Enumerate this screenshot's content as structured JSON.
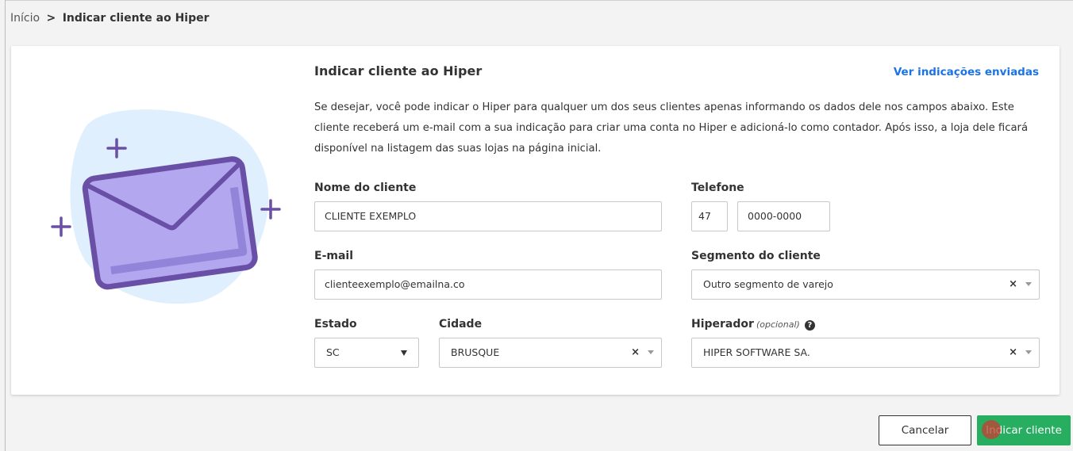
{
  "breadcrumb": {
    "home": "Início",
    "separator": ">",
    "current": "Indicar cliente ao Hiper"
  },
  "form": {
    "title": "Indicar cliente ao Hiper",
    "view_sent_link": "Ver indicações enviadas",
    "description": "Se desejar, você pode indicar o Hiper para qualquer um dos seus clientes apenas informando  os dados dele nos campos abaixo. Este cliente receberá um e-mail com a sua indicação para criar  uma conta no Hiper e adicioná-lo como contador. Após isso, a loja dele ficará disponível na  listagem das suas lojas na página inicial.",
    "client_name": {
      "label": "Nome do cliente",
      "value": "CLIENTE EXEMPLO"
    },
    "phone": {
      "label": "Telefone",
      "area_code": "47",
      "number": "0000-0000"
    },
    "email": {
      "label": "E-mail",
      "value": "clienteexemplo@emailna.co"
    },
    "segment": {
      "label": "Segmento do cliente",
      "value": "Outro segmento de varejo",
      "clear": "×"
    },
    "state": {
      "label": "Estado",
      "value": "SC"
    },
    "city": {
      "label": "Cidade",
      "value": "BRUSQUE",
      "clear": "×"
    },
    "hiperador": {
      "label": "Hiperador",
      "optional": "(opcional)",
      "help": "?",
      "value": "HIPER SOFTWARE SA.",
      "clear": "×"
    }
  },
  "buttons": {
    "cancel": "Cancelar",
    "submit": "Indicar cliente"
  },
  "icons": {
    "illustration": "envelope-icon",
    "plus": "plus-icon",
    "help": "question-circle-icon"
  },
  "colors": {
    "accent_link": "#1a73e8",
    "submit_button": "#27ae60",
    "envelope_fill": "#b3a8ef",
    "envelope_stroke": "#6a4fa6",
    "illustration_bg": "#dfeffd"
  }
}
